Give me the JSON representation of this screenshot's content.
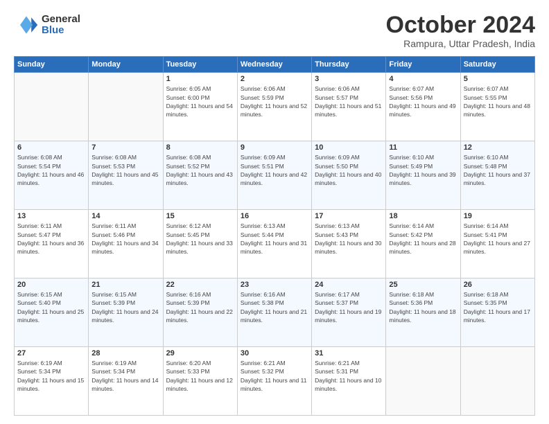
{
  "logo": {
    "general": "General",
    "blue": "Blue"
  },
  "header": {
    "month": "October 2024",
    "location": "Rampura, Uttar Pradesh, India"
  },
  "weekdays": [
    "Sunday",
    "Monday",
    "Tuesday",
    "Wednesday",
    "Thursday",
    "Friday",
    "Saturday"
  ],
  "days": [
    {
      "date": "",
      "sunrise": "",
      "sunset": "",
      "daylight": ""
    },
    {
      "date": "",
      "sunrise": "",
      "sunset": "",
      "daylight": ""
    },
    {
      "date": "1",
      "sunrise": "Sunrise: 6:05 AM",
      "sunset": "Sunset: 6:00 PM",
      "daylight": "Daylight: 11 hours and 54 minutes."
    },
    {
      "date": "2",
      "sunrise": "Sunrise: 6:06 AM",
      "sunset": "Sunset: 5:59 PM",
      "daylight": "Daylight: 11 hours and 52 minutes."
    },
    {
      "date": "3",
      "sunrise": "Sunrise: 6:06 AM",
      "sunset": "Sunset: 5:57 PM",
      "daylight": "Daylight: 11 hours and 51 minutes."
    },
    {
      "date": "4",
      "sunrise": "Sunrise: 6:07 AM",
      "sunset": "Sunset: 5:56 PM",
      "daylight": "Daylight: 11 hours and 49 minutes."
    },
    {
      "date": "5",
      "sunrise": "Sunrise: 6:07 AM",
      "sunset": "Sunset: 5:55 PM",
      "daylight": "Daylight: 11 hours and 48 minutes."
    },
    {
      "date": "6",
      "sunrise": "Sunrise: 6:08 AM",
      "sunset": "Sunset: 5:54 PM",
      "daylight": "Daylight: 11 hours and 46 minutes."
    },
    {
      "date": "7",
      "sunrise": "Sunrise: 6:08 AM",
      "sunset": "Sunset: 5:53 PM",
      "daylight": "Daylight: 11 hours and 45 minutes."
    },
    {
      "date": "8",
      "sunrise": "Sunrise: 6:08 AM",
      "sunset": "Sunset: 5:52 PM",
      "daylight": "Daylight: 11 hours and 43 minutes."
    },
    {
      "date": "9",
      "sunrise": "Sunrise: 6:09 AM",
      "sunset": "Sunset: 5:51 PM",
      "daylight": "Daylight: 11 hours and 42 minutes."
    },
    {
      "date": "10",
      "sunrise": "Sunrise: 6:09 AM",
      "sunset": "Sunset: 5:50 PM",
      "daylight": "Daylight: 11 hours and 40 minutes."
    },
    {
      "date": "11",
      "sunrise": "Sunrise: 6:10 AM",
      "sunset": "Sunset: 5:49 PM",
      "daylight": "Daylight: 11 hours and 39 minutes."
    },
    {
      "date": "12",
      "sunrise": "Sunrise: 6:10 AM",
      "sunset": "Sunset: 5:48 PM",
      "daylight": "Daylight: 11 hours and 37 minutes."
    },
    {
      "date": "13",
      "sunrise": "Sunrise: 6:11 AM",
      "sunset": "Sunset: 5:47 PM",
      "daylight": "Daylight: 11 hours and 36 minutes."
    },
    {
      "date": "14",
      "sunrise": "Sunrise: 6:11 AM",
      "sunset": "Sunset: 5:46 PM",
      "daylight": "Daylight: 11 hours and 34 minutes."
    },
    {
      "date": "15",
      "sunrise": "Sunrise: 6:12 AM",
      "sunset": "Sunset: 5:45 PM",
      "daylight": "Daylight: 11 hours and 33 minutes."
    },
    {
      "date": "16",
      "sunrise": "Sunrise: 6:13 AM",
      "sunset": "Sunset: 5:44 PM",
      "daylight": "Daylight: 11 hours and 31 minutes."
    },
    {
      "date": "17",
      "sunrise": "Sunrise: 6:13 AM",
      "sunset": "Sunset: 5:43 PM",
      "daylight": "Daylight: 11 hours and 30 minutes."
    },
    {
      "date": "18",
      "sunrise": "Sunrise: 6:14 AM",
      "sunset": "Sunset: 5:42 PM",
      "daylight": "Daylight: 11 hours and 28 minutes."
    },
    {
      "date": "19",
      "sunrise": "Sunrise: 6:14 AM",
      "sunset": "Sunset: 5:41 PM",
      "daylight": "Daylight: 11 hours and 27 minutes."
    },
    {
      "date": "20",
      "sunrise": "Sunrise: 6:15 AM",
      "sunset": "Sunset: 5:40 PM",
      "daylight": "Daylight: 11 hours and 25 minutes."
    },
    {
      "date": "21",
      "sunrise": "Sunrise: 6:15 AM",
      "sunset": "Sunset: 5:39 PM",
      "daylight": "Daylight: 11 hours and 24 minutes."
    },
    {
      "date": "22",
      "sunrise": "Sunrise: 6:16 AM",
      "sunset": "Sunset: 5:39 PM",
      "daylight": "Daylight: 11 hours and 22 minutes."
    },
    {
      "date": "23",
      "sunrise": "Sunrise: 6:16 AM",
      "sunset": "Sunset: 5:38 PM",
      "daylight": "Daylight: 11 hours and 21 minutes."
    },
    {
      "date": "24",
      "sunrise": "Sunrise: 6:17 AM",
      "sunset": "Sunset: 5:37 PM",
      "daylight": "Daylight: 11 hours and 19 minutes."
    },
    {
      "date": "25",
      "sunrise": "Sunrise: 6:18 AM",
      "sunset": "Sunset: 5:36 PM",
      "daylight": "Daylight: 11 hours and 18 minutes."
    },
    {
      "date": "26",
      "sunrise": "Sunrise: 6:18 AM",
      "sunset": "Sunset: 5:35 PM",
      "daylight": "Daylight: 11 hours and 17 minutes."
    },
    {
      "date": "27",
      "sunrise": "Sunrise: 6:19 AM",
      "sunset": "Sunset: 5:34 PM",
      "daylight": "Daylight: 11 hours and 15 minutes."
    },
    {
      "date": "28",
      "sunrise": "Sunrise: 6:19 AM",
      "sunset": "Sunset: 5:34 PM",
      "daylight": "Daylight: 11 hours and 14 minutes."
    },
    {
      "date": "29",
      "sunrise": "Sunrise: 6:20 AM",
      "sunset": "Sunset: 5:33 PM",
      "daylight": "Daylight: 11 hours and 12 minutes."
    },
    {
      "date": "30",
      "sunrise": "Sunrise: 6:21 AM",
      "sunset": "Sunset: 5:32 PM",
      "daylight": "Daylight: 11 hours and 11 minutes."
    },
    {
      "date": "31",
      "sunrise": "Sunrise: 6:21 AM",
      "sunset": "Sunset: 5:31 PM",
      "daylight": "Daylight: 11 hours and 10 minutes."
    },
    {
      "date": "",
      "sunrise": "",
      "sunset": "",
      "daylight": ""
    },
    {
      "date": "",
      "sunrise": "",
      "sunset": "",
      "daylight": ""
    }
  ]
}
